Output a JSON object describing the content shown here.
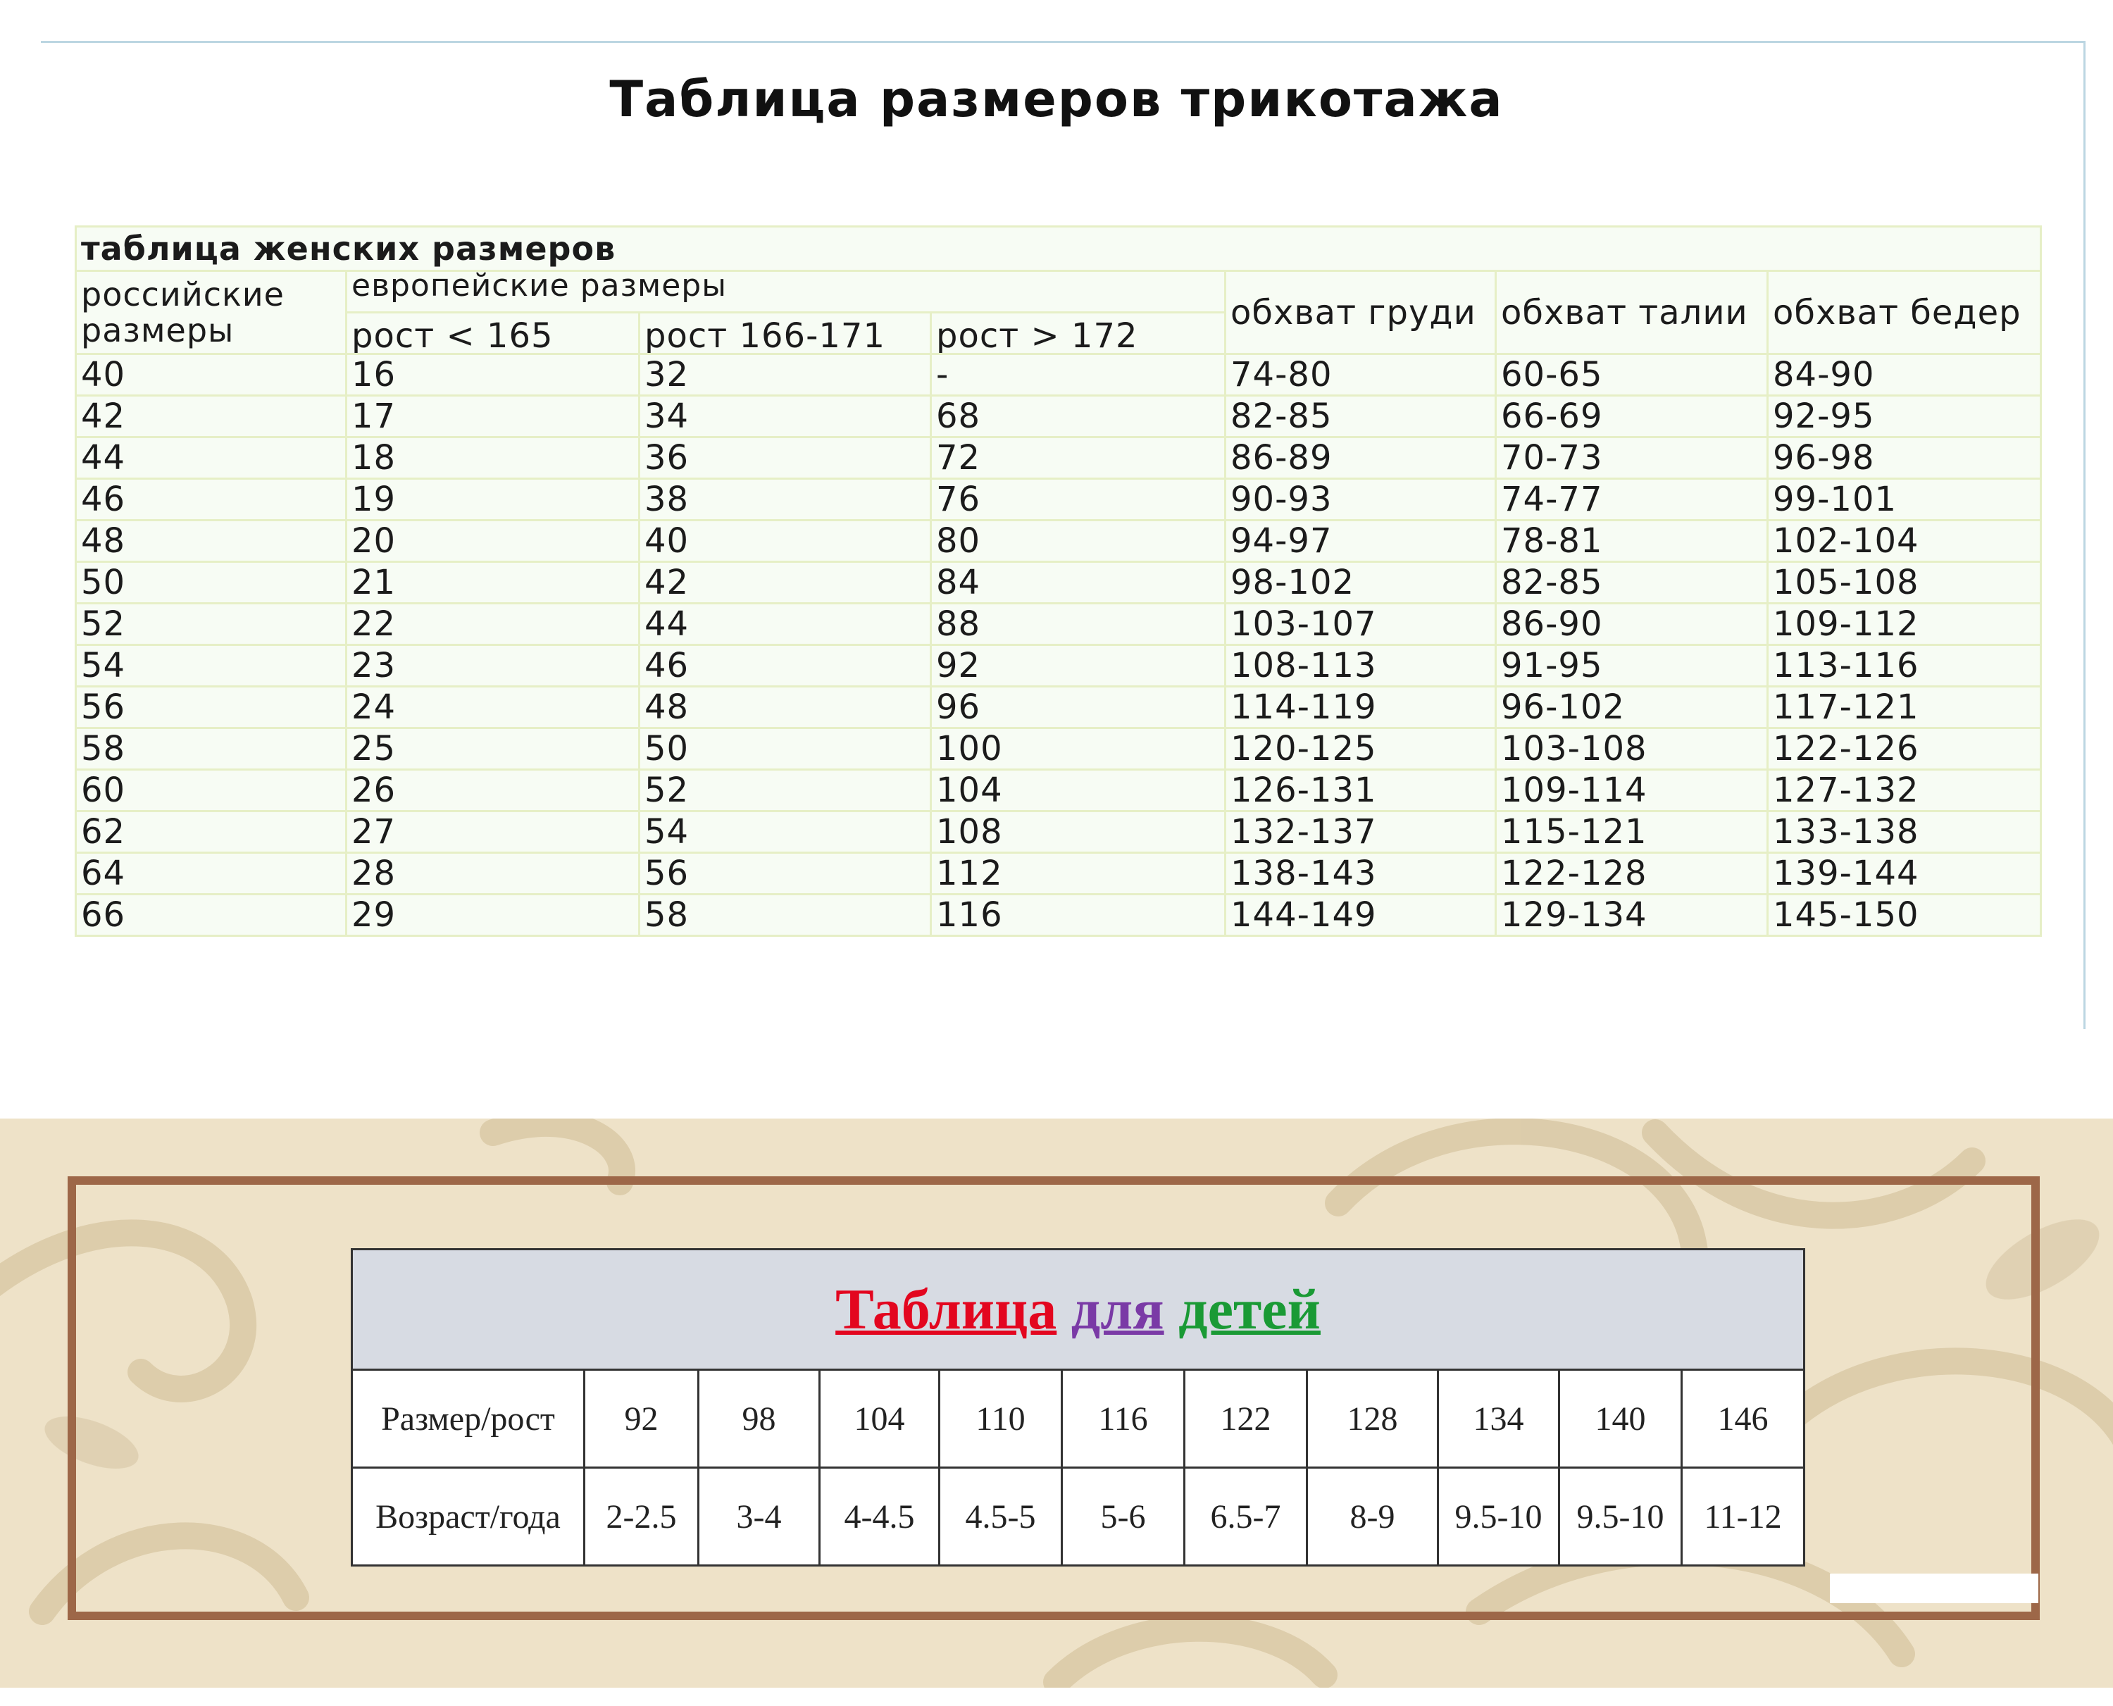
{
  "title": "Таблица размеров трикотажа",
  "women": {
    "caption": "таблица женских размеров",
    "headers": {
      "russian": "российские размеры",
      "european": "европейские размеры",
      "height_lt_165": "рост < 165",
      "height_166_171": "рост 166-171",
      "height_gt_172": "рост > 172",
      "bust": "обхват груди",
      "waist": "обхват талии",
      "hips": "обхват бедер"
    },
    "rows": [
      [
        "40",
        "16",
        "32",
        "-",
        "74-80",
        "60-65",
        "84-90"
      ],
      [
        "42",
        "17",
        "34",
        "68",
        "82-85",
        "66-69",
        "92-95"
      ],
      [
        "44",
        "18",
        "36",
        "72",
        "86-89",
        "70-73",
        "96-98"
      ],
      [
        "46",
        "19",
        "38",
        "76",
        "90-93",
        "74-77",
        "99-101"
      ],
      [
        "48",
        "20",
        "40",
        "80",
        "94-97",
        "78-81",
        "102-104"
      ],
      [
        "50",
        "21",
        "42",
        "84",
        "98-102",
        "82-85",
        "105-108"
      ],
      [
        "52",
        "22",
        "44",
        "88",
        "103-107",
        "86-90",
        "109-112"
      ],
      [
        "54",
        "23",
        "46",
        "92",
        "108-113",
        "91-95",
        "113-116"
      ],
      [
        "56",
        "24",
        "48",
        "96",
        "114-119",
        "96-102",
        "117-121"
      ],
      [
        "58",
        "25",
        "50",
        "100",
        "120-125",
        "103-108",
        "122-126"
      ],
      [
        "60",
        "26",
        "52",
        "104",
        "126-131",
        "109-114",
        "127-132"
      ],
      [
        "62",
        "27",
        "54",
        "108",
        "132-137",
        "115-121",
        "133-138"
      ],
      [
        "64",
        "28",
        "56",
        "112",
        "138-143",
        "122-128",
        "139-144"
      ],
      [
        "66",
        "29",
        "58",
        "116",
        "144-149",
        "129-134",
        "145-150"
      ]
    ]
  },
  "kids": {
    "title_word1": "Таблица",
    "title_word2": "для",
    "title_word3": "детей",
    "row1_label": "Размер/рост",
    "row1": [
      "92",
      "98",
      "104",
      "110",
      "116",
      "122",
      "128",
      "134",
      "140",
      "146"
    ],
    "row2_label": "Возраст/года",
    "row2": [
      "2-2.5",
      "3-4",
      "4-4.5",
      "4.5-5",
      "5-6",
      "6.5-7",
      "8-9",
      "9.5-10",
      "9.5-10",
      "11-12"
    ],
    "colors": {
      "word1": "#e3061f",
      "word2": "#7a3aa6",
      "word3": "#1a9a35",
      "frame": "#9d6748",
      "background": "#eee2c8"
    }
  }
}
